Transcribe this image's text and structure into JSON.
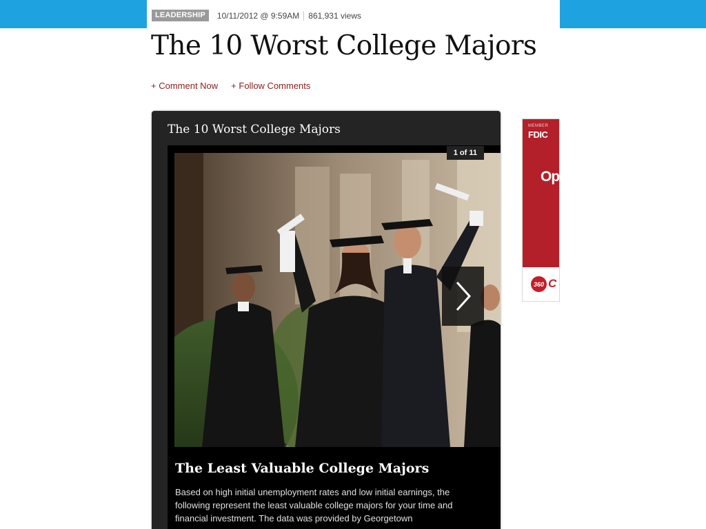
{
  "article": {
    "section_tag": "LEADERSHIP",
    "date": "10/11/2012 @ 9:59AM",
    "views": "861,931 views",
    "headline": "The 10 Worst College Majors",
    "actions": {
      "comment": "+ Comment Now",
      "follow": "+ Follow Comments"
    }
  },
  "gallery": {
    "title": "The 10 Worst College Majors",
    "counter": "1 of 11",
    "photo_alt": "Graduates in caps and gowns celebrating with diplomas",
    "slide_title": "The Least Valuable College Majors",
    "slide_body": "Based on high initial unemployment rates and low initial earnings, the following represent the least valuable college majors for your time and financial investment. The data was provided by Georgetown"
  },
  "ad": {
    "member": "MEMBER",
    "fdic": "FDIC",
    "headline": "Ope",
    "badge": "360",
    "brand": "C"
  },
  "colors": {
    "top_band": "#1fa3e0",
    "action_link": "#8a1c1c",
    "gallery_bg": "#242424",
    "ad_red": "#b3202a"
  },
  "icons": {
    "next": "chevron-right-icon",
    "ad_logo": "capital-one-360-logo"
  }
}
